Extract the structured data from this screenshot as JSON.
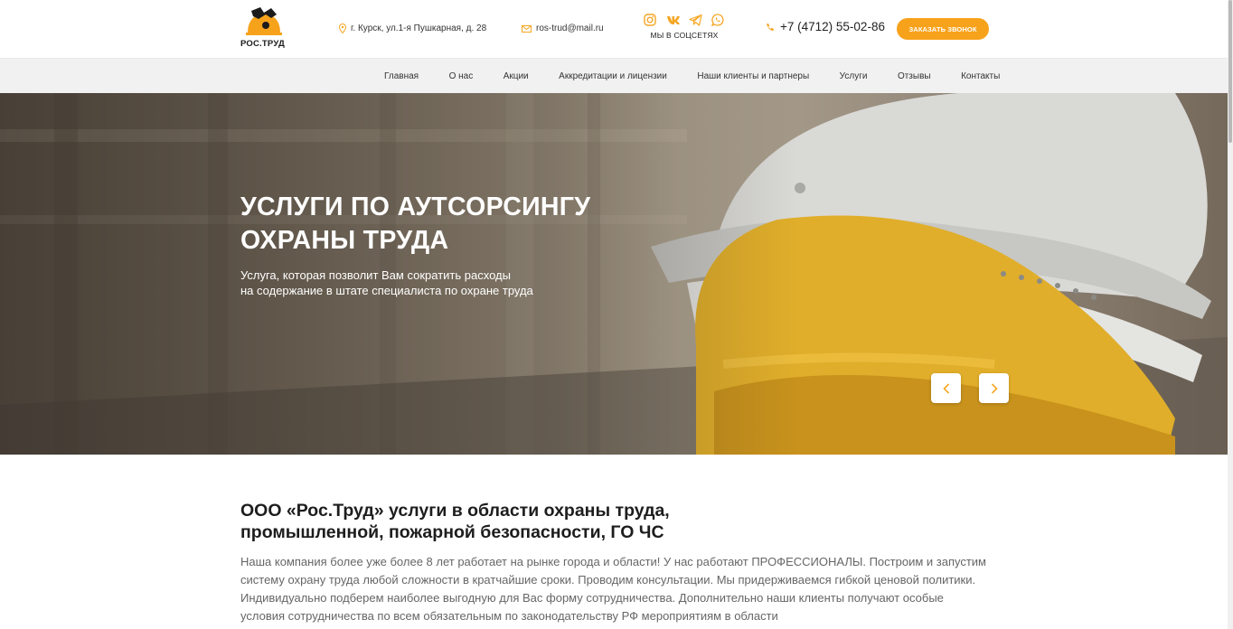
{
  "header": {
    "logo_text": "РОС.ТРУД",
    "address": "г. Курск, ул.1-я Пушкарная, д. 28",
    "email": "ros-trud@mail.ru",
    "social_label": "МЫ В СОЦСЕТЯХ",
    "social_icons": [
      "instagram-icon",
      "vk-icon",
      "telegram-icon",
      "whatsapp-icon"
    ],
    "phone": "+7 (4712) 55-02-86",
    "callback_button": "ЗАКАЗАТЬ ЗВОНОК"
  },
  "nav": {
    "items": [
      {
        "label": "Главная"
      },
      {
        "label": "О нас"
      },
      {
        "label": "Акции"
      },
      {
        "label": "Аккредитации и лицензии"
      },
      {
        "label": "Наши клиенты и партнеры"
      },
      {
        "label": "Услуги"
      },
      {
        "label": "Отзывы"
      },
      {
        "label": "Контакты"
      }
    ]
  },
  "hero": {
    "title_line1": "УСЛУГИ ПО АУТСОРСИНГУ",
    "title_line2": "ОХРАНЫ ТРУДА",
    "subtitle_line1": "Услуга, которая позволит Вам сократить расходы",
    "subtitle_line2": "на содержание в штате специалиста по охране труда",
    "prev_icon": "chevron-left-icon",
    "next_icon": "chevron-right-icon"
  },
  "about": {
    "title_line1": "ООО «Рос.Труд» услуги в области охраны труда,",
    "title_line2": "промышленной, пожарной безопасности, ГО ЧС",
    "text": "Наша компания более уже более 8 лет работает на рынке города и области! У нас работают ПРОФЕССИОНАЛЫ. Построим и запустим систему охрану труда любой сложности в кратчайшие сроки. Проводим консультации. Мы придерживаемся гибкой ценовой политики. Индивидуально подберем наиболее выгодную для Вас форму сотрудничества. Дополнительно наши клиенты получают особые условия сотрудничества по всем обязательным по законодательству РФ мероприятиям в области"
  },
  "colors": {
    "accent": "#f7a21b",
    "nav_bg": "#f1f1f1",
    "text_dark": "#1d1d1d",
    "text_muted": "#666666"
  }
}
